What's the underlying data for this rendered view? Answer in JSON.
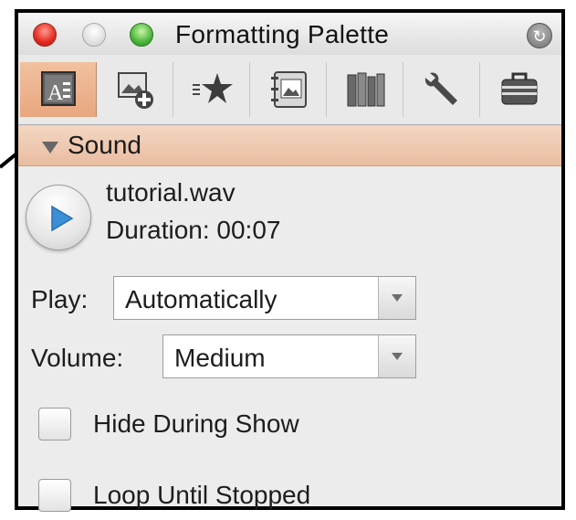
{
  "window": {
    "title": "Formatting Palette"
  },
  "toolbar": {
    "tools": [
      {
        "icon": "text-format-icon",
        "selected": true
      },
      {
        "icon": "add-picture-icon",
        "selected": false
      },
      {
        "icon": "list-star-icon",
        "selected": false
      },
      {
        "icon": "album-icon",
        "selected": false
      },
      {
        "icon": "books-icon",
        "selected": false
      },
      {
        "icon": "wrench-icon",
        "selected": false
      },
      {
        "icon": "briefcase-icon",
        "selected": false
      }
    ]
  },
  "section": {
    "label": "Sound",
    "expanded": true
  },
  "sound": {
    "file_name": "tutorial.wav",
    "duration": "Duration: 00:07",
    "play_label": "Play:",
    "play_value": "Automatically",
    "volume_label": "Volume:",
    "volume_value": "Medium",
    "hide_during_show": {
      "label": "Hide During Show",
      "checked": false
    },
    "loop_until_stopped": {
      "label": "Loop Until Stopped",
      "checked": false
    }
  },
  "colors": {
    "selected_tab": "#e8a77f",
    "section_header": "#e9bda0",
    "play_arrow": "#3b8fd6"
  }
}
